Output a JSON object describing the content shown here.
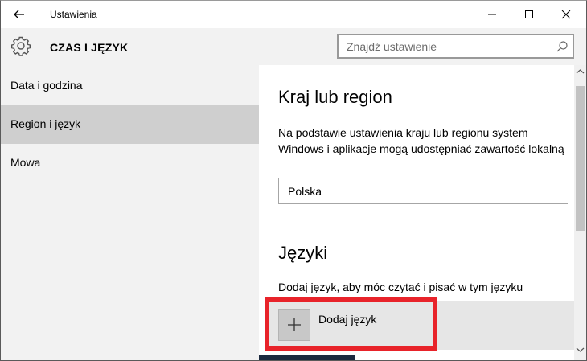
{
  "window": {
    "title": "Ustawienia"
  },
  "header": {
    "section_title": "CZAS I JĘZYK",
    "search_placeholder": "Znajdź ustawienie"
  },
  "sidebar": {
    "items": [
      {
        "label": "Data i godzina",
        "active": false
      },
      {
        "label": "Region i język",
        "active": true
      },
      {
        "label": "Mowa",
        "active": false
      }
    ]
  },
  "content": {
    "region": {
      "heading": "Kraj lub region",
      "description": "Na podstawie ustawienia kraju lub regionu system Windows i aplikacje mogą udostępniać zawartość lokalną",
      "selected_country": "Polska"
    },
    "languages": {
      "heading": "Języki",
      "description": "Dodaj język, aby móc czytać i pisać w tym języku",
      "add_button_label": "Dodaj język"
    }
  },
  "colors": {
    "highlight": "#e8232a",
    "sidebar_bg": "#f2f2f2",
    "active_item_bg": "#cfcfcf"
  },
  "icons": [
    "back-arrow-icon",
    "minimize-icon",
    "maximize-icon",
    "close-icon",
    "gear-icon",
    "search-icon",
    "plus-icon",
    "scroll-up-icon",
    "scroll-down-icon"
  ]
}
